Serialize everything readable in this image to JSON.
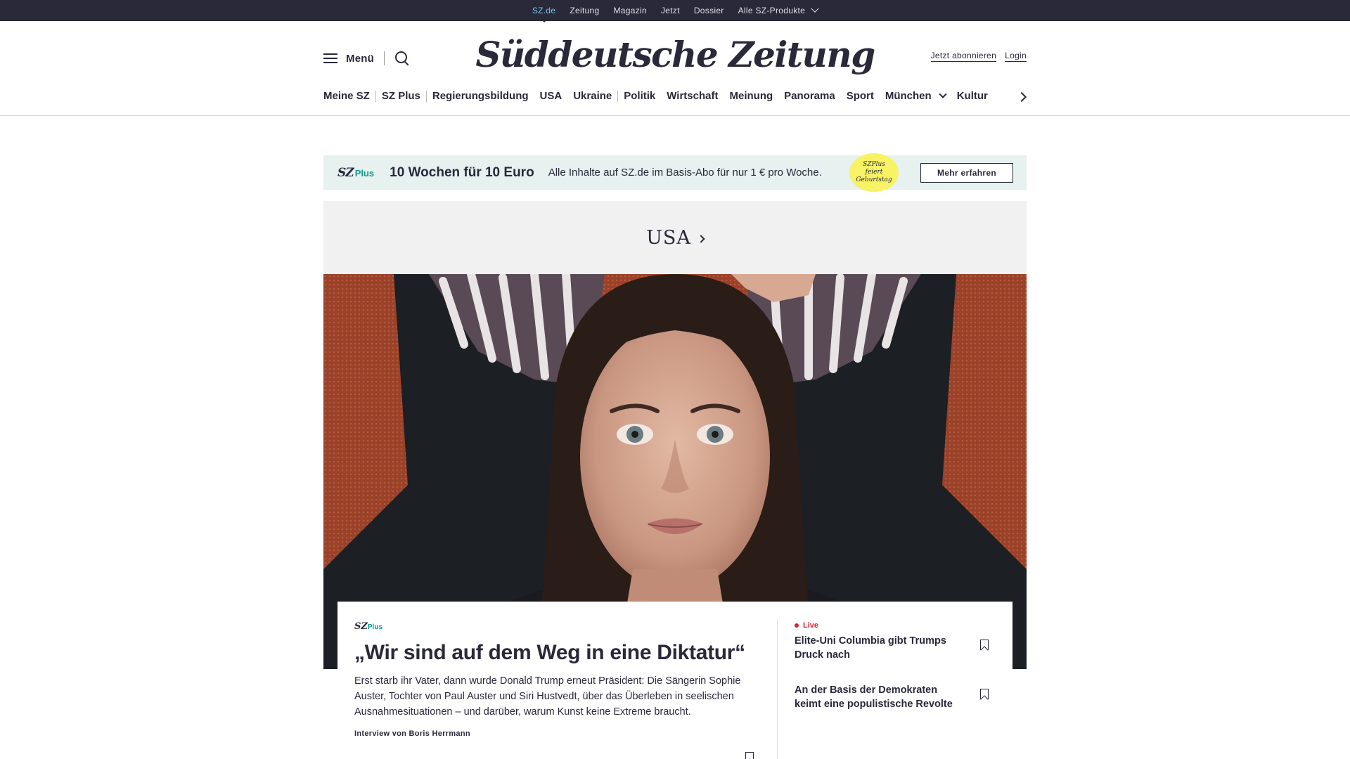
{
  "topbar": {
    "links": [
      "SZ.de",
      "Zeitung",
      "Magazin",
      "Jetzt",
      "Dossier"
    ],
    "products": "Alle SZ-Produkte"
  },
  "header": {
    "menu_label": "Menü",
    "logo": "Süddeutsche Zeitung",
    "subscribe": "Jetzt abonnieren",
    "login": "Login"
  },
  "nav": {
    "items": [
      "Meine SZ",
      "SZ Plus",
      "Regierungsbildung",
      "USA",
      "Ukraine",
      "Politik",
      "Wirtschaft",
      "Meinung",
      "Panorama",
      "Sport",
      "München",
      "Kultur"
    ]
  },
  "promo": {
    "brand_sz": "SZ",
    "brand_plus": "Plus",
    "title": "10 Wochen für 10 Euro",
    "text": "Alle Inhalte auf SZ.de im Basis-Abo für nur 1 € pro Woche.",
    "badge_line1": "SZPlus",
    "badge_line2": "feiert",
    "badge_line3": "Geburtstag",
    "button": "Mehr erfahren"
  },
  "section": {
    "title": "USA"
  },
  "article": {
    "brand_sz": "SZ",
    "brand_plus": "Plus",
    "headline": "„Wir sind auf dem Weg in eine Diktatur“",
    "teaser": "Erst starb ihr Vater, dann wurde Donald Trump erneut Präsident: Die Sängerin Sophie Auster, Tochter von Paul Auster und Siri Hustvedt, über das Überleben in seelischen Ausnahmesituationen – und darüber, warum Kunst keine Extreme braucht.",
    "byline": "Interview von Boris Herrmann"
  },
  "side_articles": [
    {
      "label": "Live",
      "title": "Elite-Uni Columbia gibt Trumps Druck nach"
    },
    {
      "label": "",
      "title": "An der Basis der Demokraten keimt eine populistische Revolte"
    }
  ],
  "colors": {
    "ink": "#29293a",
    "accent_teal": "#0f9b8e",
    "live_red": "#d4252b",
    "promo_bg": "#e6f1f0",
    "badge_yellow": "#f8f265",
    "active_link": "#71c5e8"
  }
}
